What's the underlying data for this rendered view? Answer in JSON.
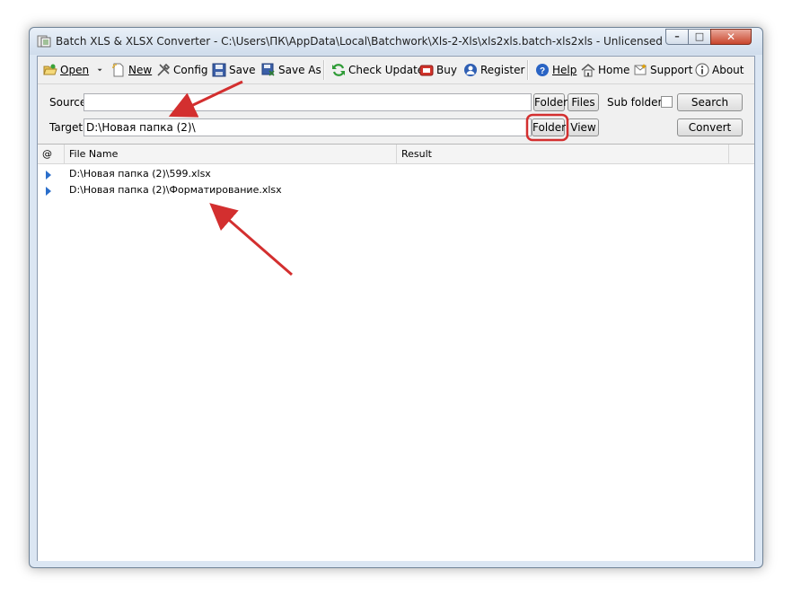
{
  "window": {
    "title": "Batch XLS & XLSX Converter - C:\\Users\\ПК\\AppData\\Local\\Batchwork\\Xls-2-Xls\\xls2xls.batch-xls2xls - Unlicensed",
    "controls": {
      "minimize": "–",
      "maximize": "□",
      "close": "✕"
    }
  },
  "toolbar": {
    "open": "Open",
    "new": "New",
    "config": "Config",
    "save": "Save",
    "save_as": "Save As",
    "check_update": "Check Update",
    "buy": "Buy",
    "register": "Register",
    "help": "Help",
    "home": "Home",
    "support": "Support",
    "about": "About"
  },
  "form": {
    "source_label": "Source",
    "source_value": "",
    "source_folder_btn": "Folder",
    "source_files_btn": "Files",
    "subfolders_label": "Sub folders",
    "subfolders_checked": false,
    "search_btn": "Search",
    "target_label": "Target",
    "target_value": "D:\\Новая папка (2)\\",
    "target_folder_btn": "Folder",
    "target_view_btn": "View",
    "convert_btn": "Convert"
  },
  "grid": {
    "columns": [
      "@",
      "File Name",
      "Result"
    ],
    "rows": [
      {
        "file": "D:\\Новая папка (2)\\599.xlsx",
        "result": ""
      },
      {
        "file": "D:\\Новая папка (2)\\Форматирование.xlsx",
        "result": ""
      }
    ]
  },
  "colors": {
    "annotation_arrow": "#d32f2f",
    "row_indicator": "#2a6ecb"
  },
  "icons": [
    "app-icon",
    "open-folder-icon",
    "dropdown-arrow-icon",
    "new-document-icon",
    "tools-icon",
    "floppy-disk-icon",
    "floppy-disk-as-icon",
    "refresh-icon",
    "cart-icon",
    "user-icon",
    "help-icon",
    "home-icon",
    "support-icon",
    "info-icon"
  ]
}
